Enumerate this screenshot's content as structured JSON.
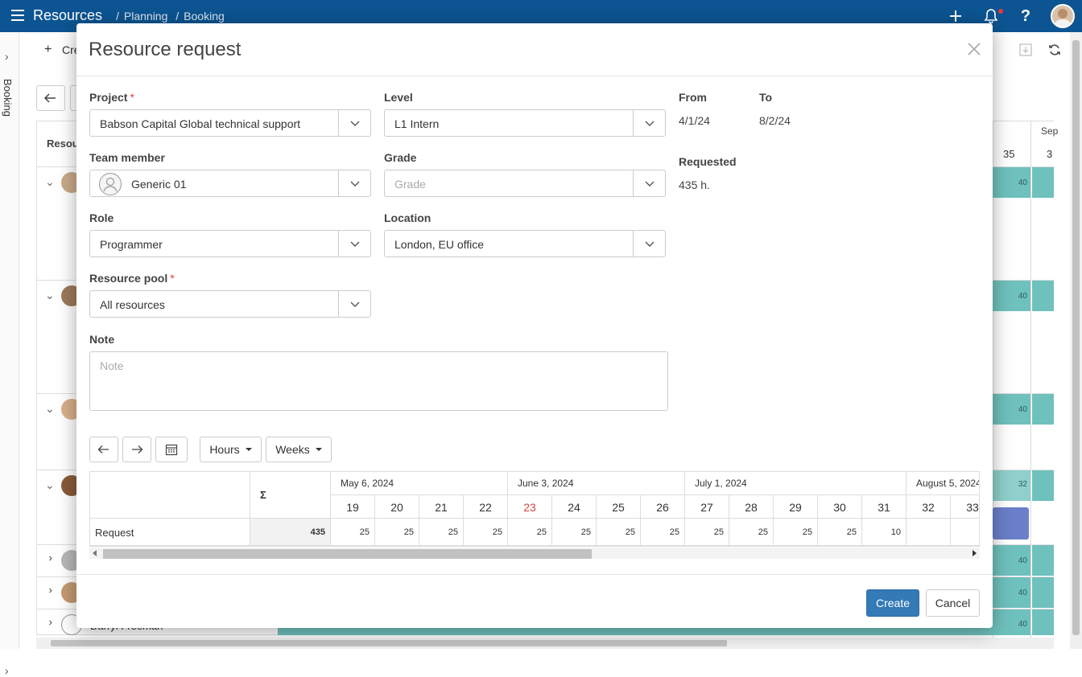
{
  "topbar": {
    "app_title": "Resources",
    "breadcrumbs": [
      "Planning",
      "Booking"
    ],
    "icons": [
      "menu-icon",
      "plus-icon",
      "bell-icon",
      "help-icon",
      "user-avatar"
    ]
  },
  "background": {
    "sidebar_label": "Booking",
    "toolbar_create": "Cre",
    "col_header": "Resou",
    "month_header": "Sep",
    "week_numbers": [
      "35",
      "3"
    ],
    "bar_values": [
      "40",
      "40",
      "40",
      "40",
      "32",
      "40",
      "40",
      "40"
    ],
    "last_row_name": "Darryl Freeman"
  },
  "modal": {
    "title": "Resource request",
    "fields": {
      "project": {
        "label": "Project",
        "value": "Babson Capital Global technical support",
        "required": true
      },
      "level": {
        "label": "Level",
        "value": "L1 Intern"
      },
      "team_member": {
        "label": "Team member",
        "value": "Generic 01"
      },
      "grade": {
        "label": "Grade",
        "placeholder": "Grade"
      },
      "role": {
        "label": "Role",
        "value": "Programmer"
      },
      "location": {
        "label": "Location",
        "value": "London, EU office"
      },
      "resource_pool": {
        "label": "Resource pool",
        "value": "All resources",
        "required": true
      },
      "note": {
        "label": "Note",
        "placeholder": "Note"
      }
    },
    "summary": {
      "from_label": "From",
      "from_value": "4/1/24",
      "to_label": "To",
      "to_value": "8/2/24",
      "requested_label": "Requested",
      "requested_value": "435 h."
    },
    "toolbar": {
      "hours_label": "Hours",
      "weeks_label": "Weeks"
    },
    "grid": {
      "sum_header": "Σ",
      "months": [
        "May 6, 2024",
        "June 3, 2024",
        "July 1, 2024",
        "August 5, 2024"
      ],
      "weeks": [
        "19",
        "20",
        "21",
        "22",
        "23",
        "24",
        "25",
        "26",
        "27",
        "28",
        "29",
        "30",
        "31",
        "32",
        "33"
      ],
      "highlight_week": "23",
      "row_label": "Request",
      "row_total": "435",
      "row_values": [
        "25",
        "25",
        "25",
        "25",
        "25",
        "25",
        "25",
        "25",
        "25",
        "25",
        "25",
        "25",
        "10",
        "",
        ""
      ]
    },
    "buttons": {
      "create": "Create",
      "cancel": "Cancel"
    },
    "colors": {
      "accent": "#337ab7",
      "topbar": "#0c5592",
      "required": "#d9433f",
      "teal_bar": "#6fc1bd"
    }
  }
}
